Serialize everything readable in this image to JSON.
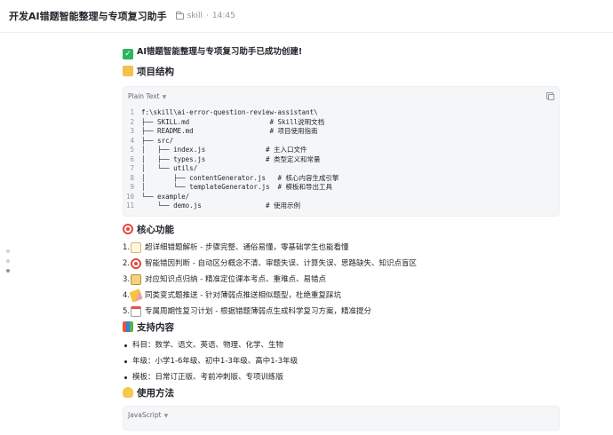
{
  "header": {
    "title": "开发AI错题智能整理与专项复习助手",
    "folder": "skill",
    "separator": "·",
    "time": "14:45"
  },
  "message": {
    "success_text": "AI错题智能整理与专项复习助手已成功创建!",
    "structure_heading": "项目结构",
    "code_block": {
      "language": "Plain Text",
      "lines": [
        {
          "num": "1",
          "text": "f:\\skill\\ai-error-question-review-assistant\\"
        },
        {
          "num": "2",
          "text": "├── SKILL.md                    # Skill说明文档"
        },
        {
          "num": "3",
          "text": "├── README.md                   # 项目使用指南"
        },
        {
          "num": "4",
          "text": "├── src/"
        },
        {
          "num": "5",
          "text": "│   ├── index.js               # 主入口文件"
        },
        {
          "num": "6",
          "text": "│   ├── types.js               # 类型定义和常量"
        },
        {
          "num": "7",
          "text": "│   └── utils/"
        },
        {
          "num": "8",
          "text": "│       ├── contentGenerator.js   # 核心内容生成引擎"
        },
        {
          "num": "9",
          "text": "│       └── templateGenerator.js  # 模板和导出工具"
        },
        {
          "num": "10",
          "text": "└── example/"
        },
        {
          "num": "11",
          "text": "    └── demo.js                # 使用示例"
        }
      ]
    },
    "features_heading": "核心功能",
    "features": [
      {
        "num": "1.",
        "icon": "memo-icon",
        "text": "超详细错题解析 - 步骤完整、通俗易懂，零基础学生也能看懂"
      },
      {
        "num": "2.",
        "icon": "target-icon",
        "text": "智能错因判断 - 自动区分概念不清、审题失误、计算失误、思路缺失、知识点盲区"
      },
      {
        "num": "3.",
        "icon": "notebook-icon",
        "text": "对应知识点归纳 - 精准定位课本考点、重难点、易错点"
      },
      {
        "num": "4.",
        "icon": "pencil-icon",
        "text": "同类变式题推送 - 针对薄弱点推送相似题型，杜绝重复踩坑"
      },
      {
        "num": "5.",
        "icon": "calendar-icon",
        "text": "专属周期性复习计划 - 根据错题薄弱点生成科学复习方案，精准提分"
      }
    ],
    "support_heading": "支持内容",
    "support": [
      "科目：数学、语文、英语、物理、化学、生物",
      "年级：小学1-6年级、初中1-3年级、高中1-3年级",
      "模板：日常订正版、考前冲刺版、专项训练版"
    ],
    "usage_heading": "使用方法",
    "usage_code_language": "JavaScript"
  },
  "colors": {
    "check": "#2db55d",
    "code_bg": "#f5f6f7",
    "muted": "#8f959e"
  }
}
